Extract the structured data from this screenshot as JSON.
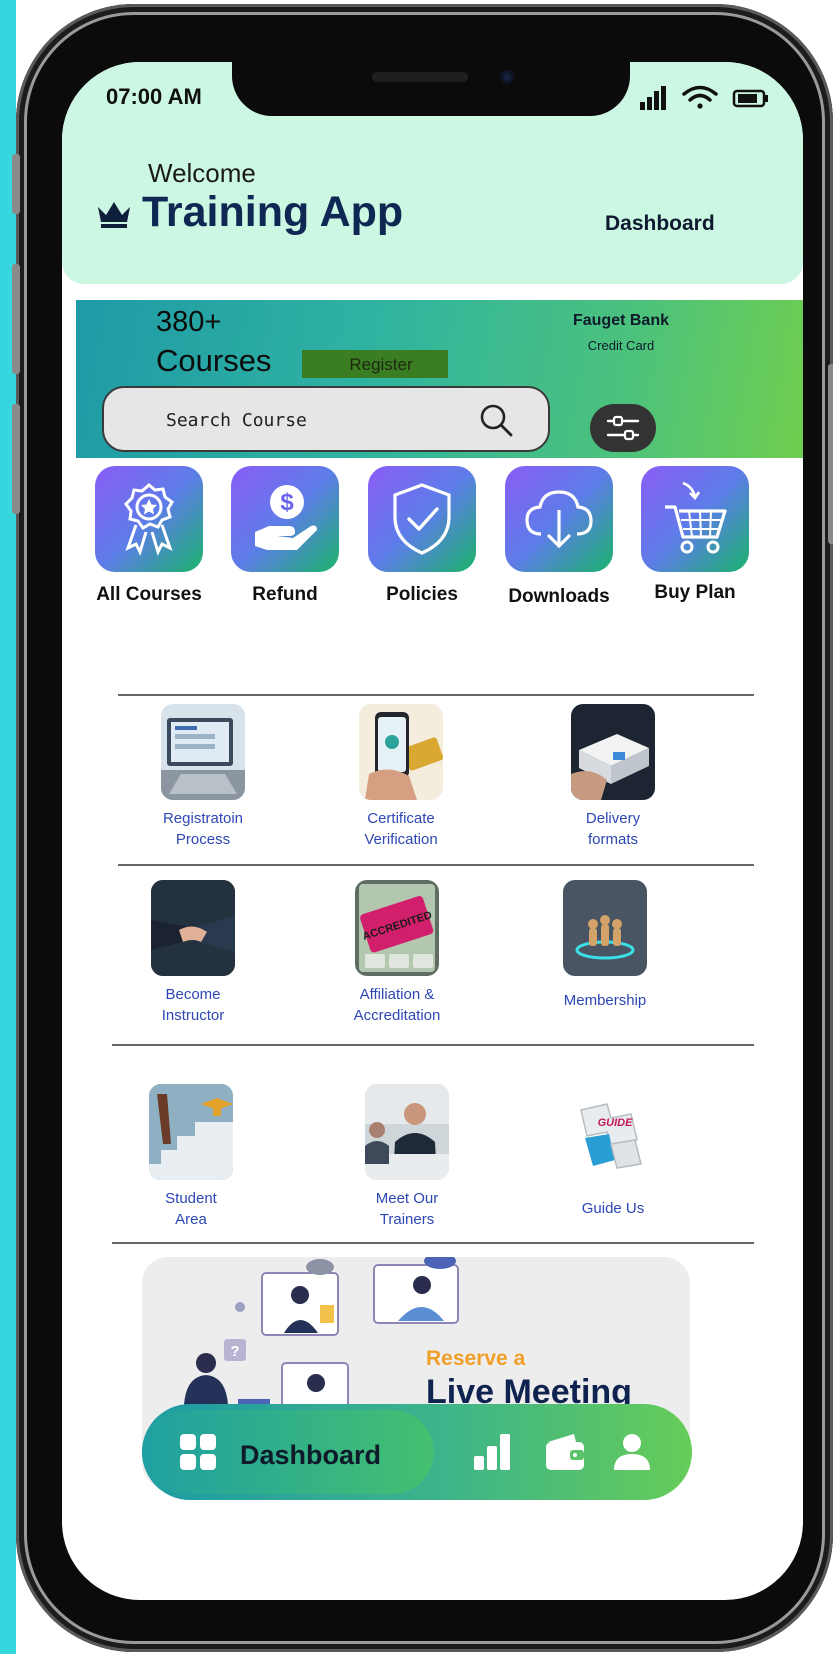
{
  "status_bar": {
    "time": "07:00 AM"
  },
  "header": {
    "welcome": "Welcome",
    "title": "Training App",
    "dashboard_link": "Dashboard"
  },
  "banner": {
    "count": "380+",
    "courses": "Courses",
    "register": "Register",
    "bank": "Fauget Bank",
    "card": "Credit Card"
  },
  "search": {
    "placeholder": "Search Course"
  },
  "categories": [
    "All Courses",
    "Refund",
    "Policies",
    "Downloads",
    "Buy Plan"
  ],
  "items": [
    {
      "line1": "Registratoin",
      "line2": "Process"
    },
    {
      "line1": "Certificate",
      "line2": "Verification"
    },
    {
      "line1": "Delivery",
      "line2": "formats"
    },
    {
      "line1": "Become",
      "line2": "Instructor"
    },
    {
      "line1": "Affiliation &",
      "line2": "Accreditation"
    },
    {
      "line1": "Membership",
      "line2": ""
    },
    {
      "line1": "Student",
      "line2": "Area"
    },
    {
      "line1": "Meet Our",
      "line2": "Trainers"
    },
    {
      "line1": "Guide Us",
      "line2": ""
    }
  ],
  "promo": {
    "reserve": "Reserve a",
    "live": "Live Meeting"
  },
  "nav": {
    "dashboard": "Dashboard"
  },
  "colors": {
    "header_bg": "#ccf7e3",
    "title": "#0f2753",
    "link_blue": "#2d47b4",
    "accent_orange": "#f0a028",
    "frame_accent": "#35d6dd"
  }
}
